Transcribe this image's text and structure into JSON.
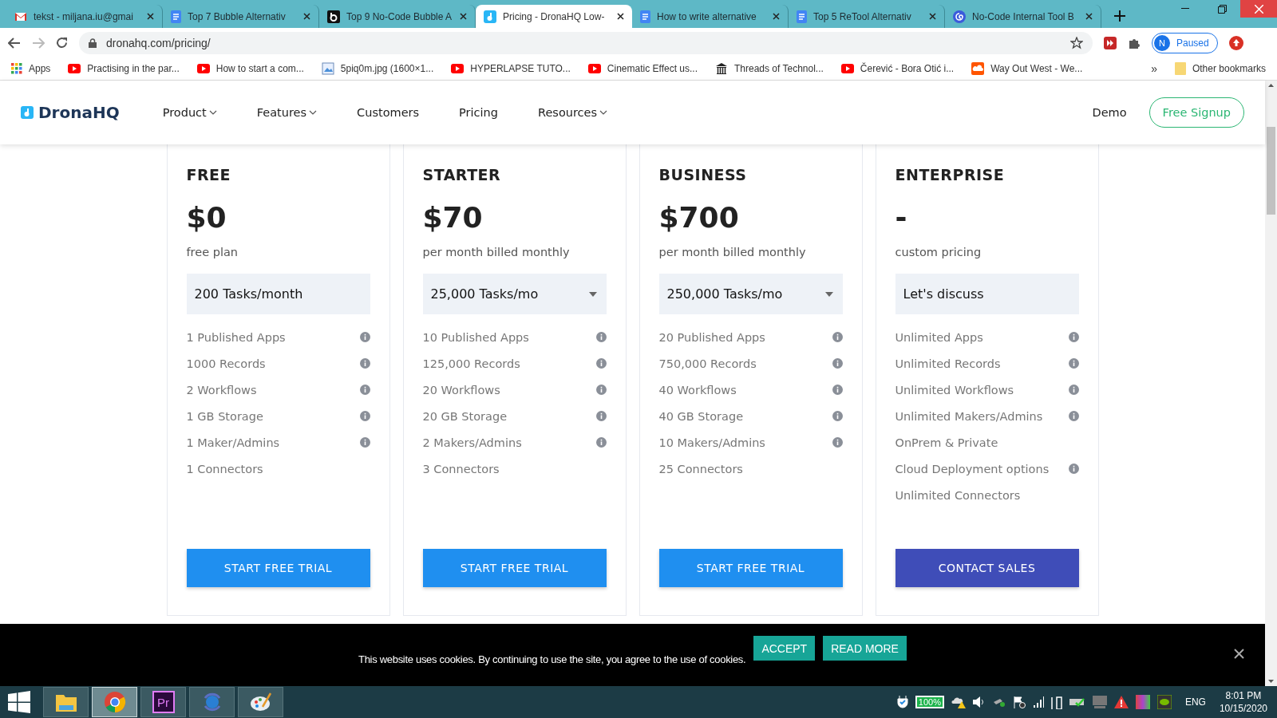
{
  "browser": {
    "tabs": [
      {
        "title": "tekst - miljana.iu@gmai",
        "kind": "mail",
        "selected": false
      },
      {
        "title": "Top 7 Bubble Alternativ",
        "kind": "doc",
        "selected": false
      },
      {
        "title": "Top 9 No-Code Bubble A",
        "kind": "bubble",
        "selected": false
      },
      {
        "title": "Pricing - DronaHQ Low-",
        "kind": "drona",
        "selected": true
      },
      {
        "title": "How to write alternative",
        "kind": "doc",
        "selected": false
      },
      {
        "title": "Top 5 ReTool Alternativ",
        "kind": "doc",
        "selected": false
      },
      {
        "title": "No-Code Internal Tool B",
        "kind": "swirl",
        "selected": false
      }
    ],
    "address": "dronahq.com/pricing/",
    "profile": {
      "initial": "N",
      "label": "Paused"
    },
    "bookmarks": [
      {
        "label": "Apps",
        "kind": "apps"
      },
      {
        "label": "Practising in the par...",
        "kind": "video"
      },
      {
        "label": "How to start a com...",
        "kind": "video"
      },
      {
        "label": "5piq0m.jpg (1600×1...",
        "kind": "image"
      },
      {
        "label": "HYPERLAPSE TUTO...",
        "kind": "video"
      },
      {
        "label": "Cinematic Effect us...",
        "kind": "video"
      },
      {
        "label": "Threads of Technol...",
        "kind": "building"
      },
      {
        "label": "Čerević - Bora Otić i...",
        "kind": "video"
      },
      {
        "label": "Way Out West - We...",
        "kind": "cloud"
      }
    ],
    "more": "»",
    "other": "Other bookmarks"
  },
  "header": {
    "logo": "DronaHQ",
    "nav": [
      {
        "label": "Product",
        "dropdown": true
      },
      {
        "label": "Features",
        "dropdown": true
      },
      {
        "label": "Customers",
        "dropdown": false
      },
      {
        "label": "Pricing",
        "dropdown": false
      },
      {
        "label": "Resources",
        "dropdown": true
      }
    ],
    "demo": "Demo",
    "signup": "Free Signup"
  },
  "plans": [
    {
      "name": "FREE",
      "price": "$0",
      "note": "free plan",
      "tasks": "200 Tasks/month",
      "dropdown": false,
      "features": [
        {
          "label": "1 Published Apps",
          "info": true
        },
        {
          "label": "1000 Records",
          "info": true
        },
        {
          "label": "2 Workflows",
          "info": true
        },
        {
          "label": "1 GB Storage",
          "info": true
        },
        {
          "label": "1 Maker/Admins",
          "info": true
        },
        {
          "label": "1 Connectors",
          "info": false
        }
      ],
      "button": {
        "label": "START FREE TRIAL",
        "kind": "trial"
      }
    },
    {
      "name": "STARTER",
      "price": "$70",
      "note": "per month billed monthly",
      "tasks": "25,000 Tasks/mo",
      "dropdown": true,
      "features": [
        {
          "label": "10 Published Apps",
          "info": true
        },
        {
          "label": "125,000 Records",
          "info": true
        },
        {
          "label": "20 Workflows",
          "info": true
        },
        {
          "label": "20 GB Storage",
          "info": true
        },
        {
          "label": "2 Makers/Admins",
          "info": true
        },
        {
          "label": "3 Connectors",
          "info": false
        }
      ],
      "button": {
        "label": "START FREE TRIAL",
        "kind": "trial"
      }
    },
    {
      "name": "BUSINESS",
      "price": "$700",
      "note": "per month billed monthly",
      "tasks": "250,000 Tasks/mo",
      "dropdown": true,
      "features": [
        {
          "label": "20 Published Apps",
          "info": true
        },
        {
          "label": "750,000 Records",
          "info": true
        },
        {
          "label": "40 Workflows",
          "info": true
        },
        {
          "label": "40 GB Storage",
          "info": true
        },
        {
          "label": "10 Makers/Admins",
          "info": true
        },
        {
          "label": "25 Connectors",
          "info": false
        }
      ],
      "button": {
        "label": "START FREE TRIAL",
        "kind": "trial"
      }
    },
    {
      "name": "ENTERPRISE",
      "price": "-",
      "note": "custom pricing",
      "tasks": "Let's discuss",
      "dropdown": false,
      "features": [
        {
          "label": "Unlimited Apps",
          "info": true
        },
        {
          "label": "Unlimited Records",
          "info": true
        },
        {
          "label": "Unlimited Workflows",
          "info": true
        },
        {
          "label": "Unlimited Makers/Admins",
          "info": true
        },
        {
          "label": "OnPrem & Private",
          "info": false
        },
        {
          "label": "Cloud Deployment options",
          "info": true
        },
        {
          "label": "Unlimited Connectors",
          "info": false
        }
      ],
      "button": {
        "label": "CONTACT SALES",
        "kind": "sales"
      }
    }
  ],
  "cookie": {
    "text": "This website uses cookies. By continuing to use the site, you agree to the use of cookies.",
    "accept": "ACCEPT",
    "read_more": "READ MORE"
  },
  "taskbar": {
    "apps": [
      {
        "kind": "explorer",
        "selected": false
      },
      {
        "kind": "chrome",
        "selected": true
      },
      {
        "kind": "premiere",
        "label": "Pr",
        "selected": false
      },
      {
        "kind": "sync",
        "selected": false
      },
      {
        "kind": "paint",
        "selected": false
      }
    ],
    "battery": "100%",
    "language": "ENG",
    "time": "8:01 PM",
    "date": "10/15/2020"
  }
}
